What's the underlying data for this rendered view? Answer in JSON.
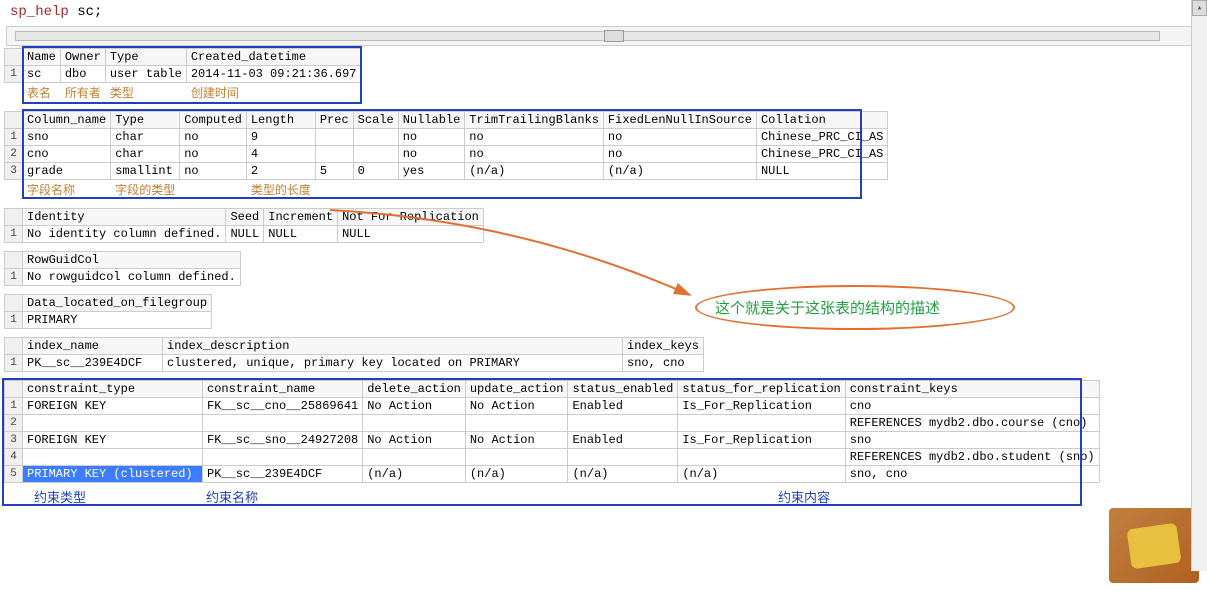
{
  "sql": {
    "cmd": "sp_help",
    "arg": "sc;"
  },
  "block1": {
    "headers": [
      "Name",
      "Owner",
      "Type",
      "Created_datetime"
    ],
    "row": [
      "sc",
      "dbo",
      "user table",
      "2014-11-03 09:21:36.697"
    ],
    "annot": [
      "表名",
      "所有者",
      "类型",
      "创建时间"
    ]
  },
  "block2": {
    "headers": [
      "Column_name",
      "Type",
      "Computed",
      "Length",
      "Prec",
      "Scale",
      "Nullable",
      "TrimTrailingBlanks",
      "FixedLenNullInSource",
      "Collation"
    ],
    "rows": [
      [
        "sno",
        "char",
        "no",
        "9",
        "",
        "",
        "no",
        "no",
        "no",
        "Chinese_PRC_CI_AS"
      ],
      [
        "cno",
        "char",
        "no",
        "4",
        "",
        "",
        "no",
        "no",
        "no",
        "Chinese_PRC_CI_AS"
      ],
      [
        "grade",
        "smallint",
        "no",
        "2",
        "5",
        "0",
        "yes",
        "(n/a)",
        "(n/a)",
        "NULL"
      ]
    ],
    "annot": [
      "字段名称",
      "字段的类型",
      "",
      "类型的长度",
      "",
      "",
      "",
      "",
      "",
      ""
    ]
  },
  "block3": {
    "headers": [
      "Identity",
      "Seed",
      "Increment",
      "Not For Replication"
    ],
    "row": [
      "No identity column defined.",
      "NULL",
      "NULL",
      "NULL"
    ]
  },
  "block4": {
    "headers": [
      "RowGuidCol"
    ],
    "row": [
      "No rowguidcol column defined."
    ]
  },
  "block5": {
    "headers": [
      "Data_located_on_filegroup"
    ],
    "row": [
      "PRIMARY"
    ]
  },
  "block6": {
    "headers": [
      "index_name",
      "index_description",
      "index_keys"
    ],
    "row": [
      "PK__sc__239E4DCF",
      "clustered, unique, primary key located on PRIMARY",
      "sno, cno"
    ]
  },
  "block7": {
    "headers": [
      "constraint_type",
      "constraint_name",
      "delete_action",
      "update_action",
      "status_enabled",
      "status_for_replication",
      "constraint_keys"
    ],
    "rows": [
      [
        "FOREIGN KEY",
        "FK__sc__cno__25869641",
        "No Action",
        "No Action",
        "Enabled",
        "Is_For_Replication",
        "cno"
      ],
      [
        "",
        "",
        "",
        "",
        "",
        "",
        "REFERENCES mydb2.dbo.course (cno)"
      ],
      [
        "FOREIGN KEY",
        "FK__sc__sno__24927208",
        "No Action",
        "No Action",
        "Enabled",
        "Is_For_Replication",
        "sno"
      ],
      [
        "",
        "",
        "",
        "",
        "",
        "",
        "REFERENCES mydb2.dbo.student (sno)"
      ],
      [
        "PRIMARY KEY (clustered)",
        "PK__sc__239E4DCF",
        "(n/a)",
        "(n/a)",
        "(n/a)",
        "(n/a)",
        "sno, cno"
      ]
    ]
  },
  "bottom_annot": {
    "a": "约束类型",
    "b": "约束名称",
    "c": "约束内容"
  },
  "callout_text": "这个就是关于这张表的结构的描述"
}
